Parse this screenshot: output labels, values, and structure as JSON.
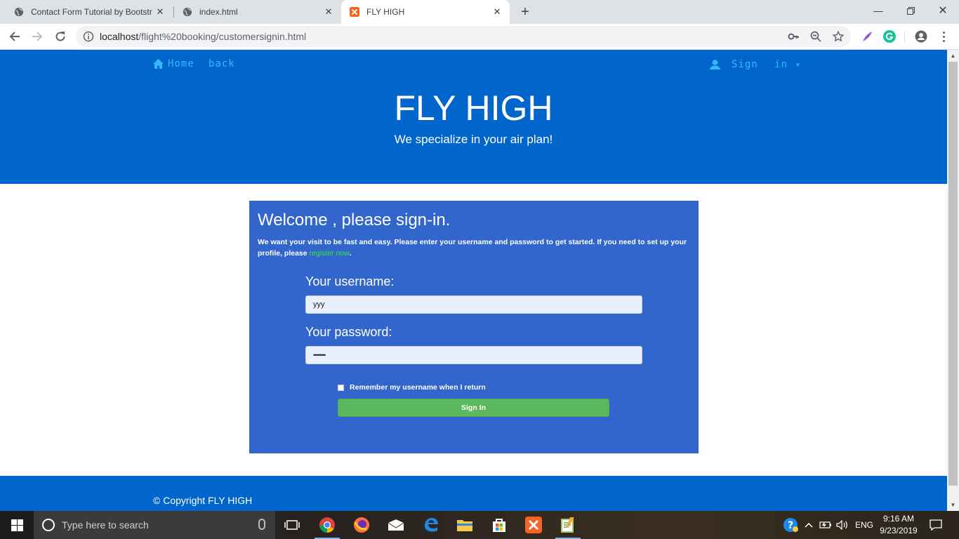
{
  "browser": {
    "tabs": [
      {
        "title": "Contact Form Tutorial by Bootstr",
        "favicon": "globe-icon",
        "active": false
      },
      {
        "title": "index.html",
        "favicon": "globe-icon",
        "active": false
      },
      {
        "title": "FLY HIGH",
        "favicon": "xampp-icon",
        "active": true
      }
    ],
    "new_tab": "+",
    "address": {
      "host": "localhost",
      "path": "/flight%20booking/customersignin.html"
    }
  },
  "page": {
    "nav": {
      "home_label": "Home",
      "back_label": "back",
      "signin_label": "Sign in"
    },
    "brand": "FLY HIGH",
    "tagline": "We specialize in your air plan!",
    "signin_panel": {
      "heading": "Welcome , please sign-in.",
      "intro_text": "We want your visit to be fast and easy. Please enter your username and password to get started. If you need to set up your profile, please",
      "register_link": "register now",
      "intro_end": ".",
      "username_label": "Your username:",
      "username_value": "yyy",
      "password_label": "Your password:",
      "password_value": "••••••••",
      "remember_label": "Remember my username when I return",
      "remember_checked": false,
      "submit_label": "Sign In"
    },
    "footer": {
      "copyright": "© Copyright FLY HIGH"
    },
    "colors": {
      "header": "#0066cc",
      "panel": "#3366cc",
      "button": "#5cb85c",
      "link": "#35b8ff",
      "register_link": "#33ee33"
    }
  },
  "taskbar": {
    "search_placeholder": "Type here to search",
    "pinned": [
      "task-view-icon",
      "chrome-icon",
      "firefox-icon",
      "mail-icon",
      "edge-icon",
      "file-explorer-icon",
      "store-icon",
      "xampp-icon",
      "notepad-icon"
    ],
    "language": "ENG",
    "time": "9:16 AM",
    "date": "9/23/2019"
  }
}
